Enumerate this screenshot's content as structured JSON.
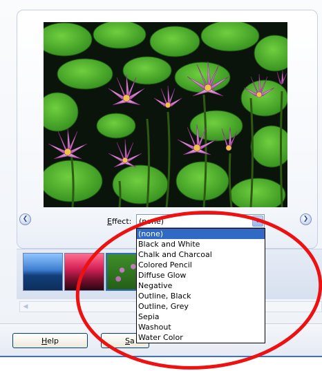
{
  "effect": {
    "label": "Effect:",
    "selected": "(none)",
    "options": [
      "(none)",
      "Black and White",
      "Chalk and Charcoal",
      "Colored Pencil",
      "Diffuse Glow",
      "Negative",
      "Outline, Black",
      "Outline, Grey",
      "Sepia",
      "Washout",
      "Water Color"
    ]
  },
  "buttons": {
    "help": "Help",
    "save": "Sa"
  },
  "icons": {
    "prev": "chevron-left-icon",
    "next": "chevron-right-icon",
    "dropdown": "chevron-down-icon",
    "scroll_left": "scroll-left-arrow-icon"
  },
  "colors": {
    "annotation_circle": "#ee1111",
    "highlight": "#316ac5",
    "accent_strip": "#3a6fd8"
  }
}
